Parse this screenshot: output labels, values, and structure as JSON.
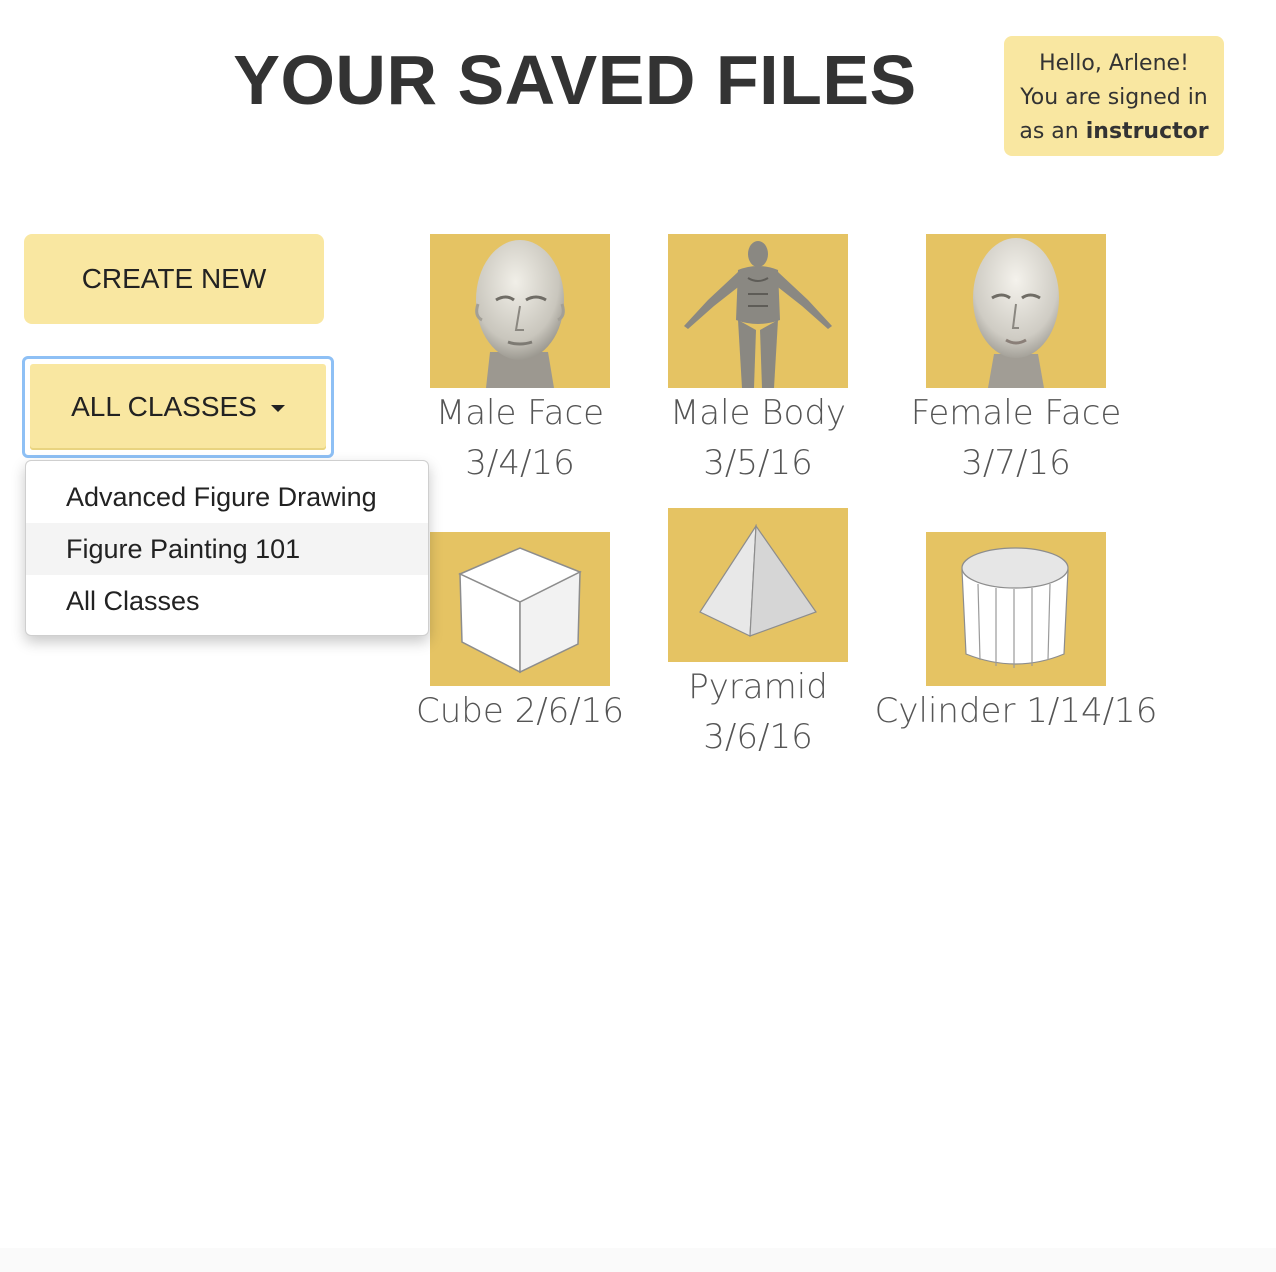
{
  "page": {
    "title": "YOUR SAVED FILES"
  },
  "greeting": {
    "line1": "Hello, Arlene!",
    "line2": "You are signed in",
    "line3_prefix": "as an",
    "role": "instructor"
  },
  "actions": {
    "create_label": "CREATE NEW",
    "classes_label": "ALL CLASSES"
  },
  "class_menu": {
    "items": [
      "Advanced Figure Drawing",
      "Figure Painting 101",
      "All Classes"
    ],
    "highlighted": "Figure Painting 101"
  },
  "files": [
    {
      "name": "Male Face",
      "date": "3/4/16",
      "icon": "male-face"
    },
    {
      "name": "Male Body",
      "date": "3/5/16",
      "icon": "male-body"
    },
    {
      "name": "Female Face",
      "date": "3/7/16",
      "icon": "female-face"
    },
    {
      "name": "Cube",
      "date": "2/6/16",
      "icon": "cube"
    },
    {
      "name": "Pyramid",
      "date": "3/6/16",
      "icon": "pyramid"
    },
    {
      "name": "Cylinder",
      "date": "1/14/16",
      "icon": "cylinder"
    }
  ],
  "colors": {
    "accent": "#f9e7a1",
    "thumb_bg": "#e5c363",
    "focus_ring": "#8ec0f5"
  }
}
